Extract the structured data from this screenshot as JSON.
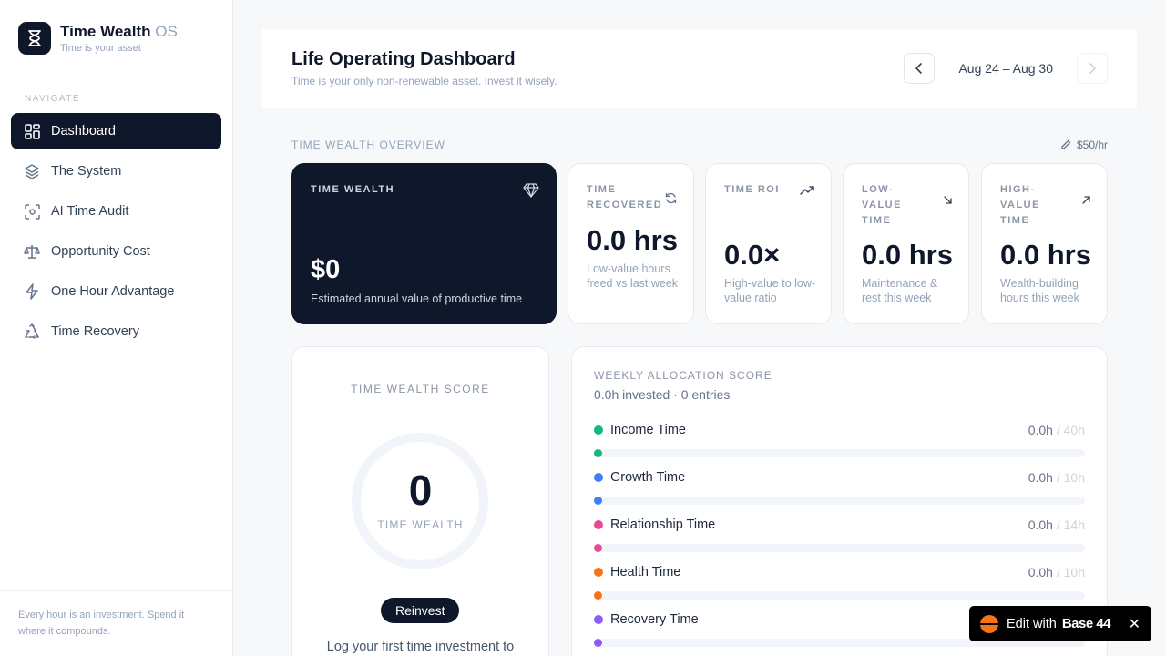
{
  "brand": {
    "name": "Time Wealth",
    "suffix": "OS",
    "tagline": "Time is your asset"
  },
  "sidebar": {
    "heading": "NAVIGATE",
    "items": [
      {
        "label": "Dashboard",
        "icon": "grid-icon",
        "active": true
      },
      {
        "label": "The System",
        "icon": "layers-icon"
      },
      {
        "label": "AI Time Audit",
        "icon": "scan-icon"
      },
      {
        "label": "Opportunity Cost",
        "icon": "scale-icon"
      },
      {
        "label": "One Hour Advantage",
        "icon": "zap-icon"
      },
      {
        "label": "Time Recovery",
        "icon": "recycle-icon"
      }
    ],
    "footer": "Every hour is an investment. Spend it where it compounds."
  },
  "header": {
    "title": "Life Operating Dashboard",
    "subtitle": "Time is your only non-renewable asset. Invest it wisely.",
    "date_range": "Aug 24 – Aug 30"
  },
  "overview": {
    "label": "TIME WEALTH OVERVIEW",
    "rate": "$50/hr",
    "cards": [
      {
        "label": "TIME WEALTH",
        "value": "$0",
        "desc": "Estimated annual value of productive time",
        "icon": "diamond-icon"
      },
      {
        "label": "TIME RECOVERED",
        "value": "0.0 hrs",
        "desc": "Low-value hours freed vs last week",
        "icon": "refresh-icon"
      },
      {
        "label": "TIME ROI",
        "value": "0.0×",
        "desc": "High-value to low-value ratio",
        "icon": "trending-up-icon"
      },
      {
        "label": "LOW-VALUE TIME",
        "value": "0.0 hrs",
        "desc": "Maintenance & rest this week",
        "icon": "arrow-down-right-icon"
      },
      {
        "label": "HIGH-VALUE TIME",
        "value": "0.0 hrs",
        "desc": "Wealth-building hours this week",
        "icon": "arrow-up-right-icon"
      }
    ]
  },
  "score": {
    "title": "TIME WEALTH SCORE",
    "value": "0",
    "unit": "TIME WEALTH",
    "button": "Reinvest",
    "hint": "Log your first time investment to"
  },
  "allocation": {
    "title": "WEEKLY ALLOCATION SCORE",
    "subtitle": "0.0h invested · 0 entries",
    "rows": [
      {
        "name": "Income Time",
        "hours": "0.0h",
        "goal": " / 40h",
        "color": "#10b981"
      },
      {
        "name": "Growth Time",
        "hours": "0.0h",
        "goal": " / 10h",
        "color": "#3b82f6"
      },
      {
        "name": "Relationship Time",
        "hours": "0.0h",
        "goal": " / 14h",
        "color": "#ec4899"
      },
      {
        "name": "Health Time",
        "hours": "0.0h",
        "goal": " / 10h",
        "color": "#f97316"
      },
      {
        "name": "Recovery Time",
        "hours": "",
        "goal": "",
        "color": "#8b5cf6"
      }
    ]
  },
  "badge": {
    "prefix": "Edit with",
    "brand": "Base 44"
  }
}
